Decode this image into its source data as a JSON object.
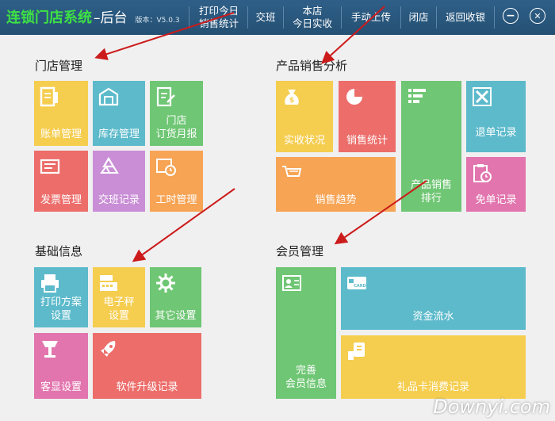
{
  "header": {
    "brand_main": "连锁门店系统",
    "brand_sub": "–后台",
    "version": "版本：V5.0.3",
    "nav": [
      {
        "label": "打印今日\n销售统计"
      },
      {
        "label": "交班"
      },
      {
        "label": "本店\n今日实收"
      },
      {
        "label": "手动上传"
      },
      {
        "label": "闭店"
      },
      {
        "label": "返回收银"
      }
    ],
    "minimize_glyph": "−",
    "close_glyph": "✕"
  },
  "sections": {
    "store": "门店管理",
    "sales": "产品销售分析",
    "basic": "基础信息",
    "member": "会员管理"
  },
  "tiles": {
    "account": "账单管理",
    "stock": "库存管理",
    "order": "门店\n订货月报",
    "invoice": "发票管理",
    "shift_record": "交班记录",
    "worktime": "工时管理",
    "receipt": "实收状况",
    "sales_stat": "销售统计",
    "sales_rank": "产品销售\n排行",
    "refund": "退单记录",
    "sales_trend": "销售趋势",
    "free_order": "免单记录",
    "print_plan": "打印方案\n设置",
    "scale": "电子秤\n设置",
    "other": "其它设置",
    "display": "客显设置",
    "upgrade": "软件升级记录",
    "member_info": "完善\n会员信息",
    "fund_flow": "资金流水",
    "gift_card": "礼品卡消费记录"
  },
  "colors": {
    "yellow": "#f5cd4f",
    "teal": "#5cbacb",
    "green": "#6fc674",
    "red": "#ec6d6a",
    "purple": "#c98ed6",
    "orange": "#f7a455",
    "pink": "#e275ae",
    "arrow": "#cc1b1b"
  },
  "watermark": "Downyi.com"
}
